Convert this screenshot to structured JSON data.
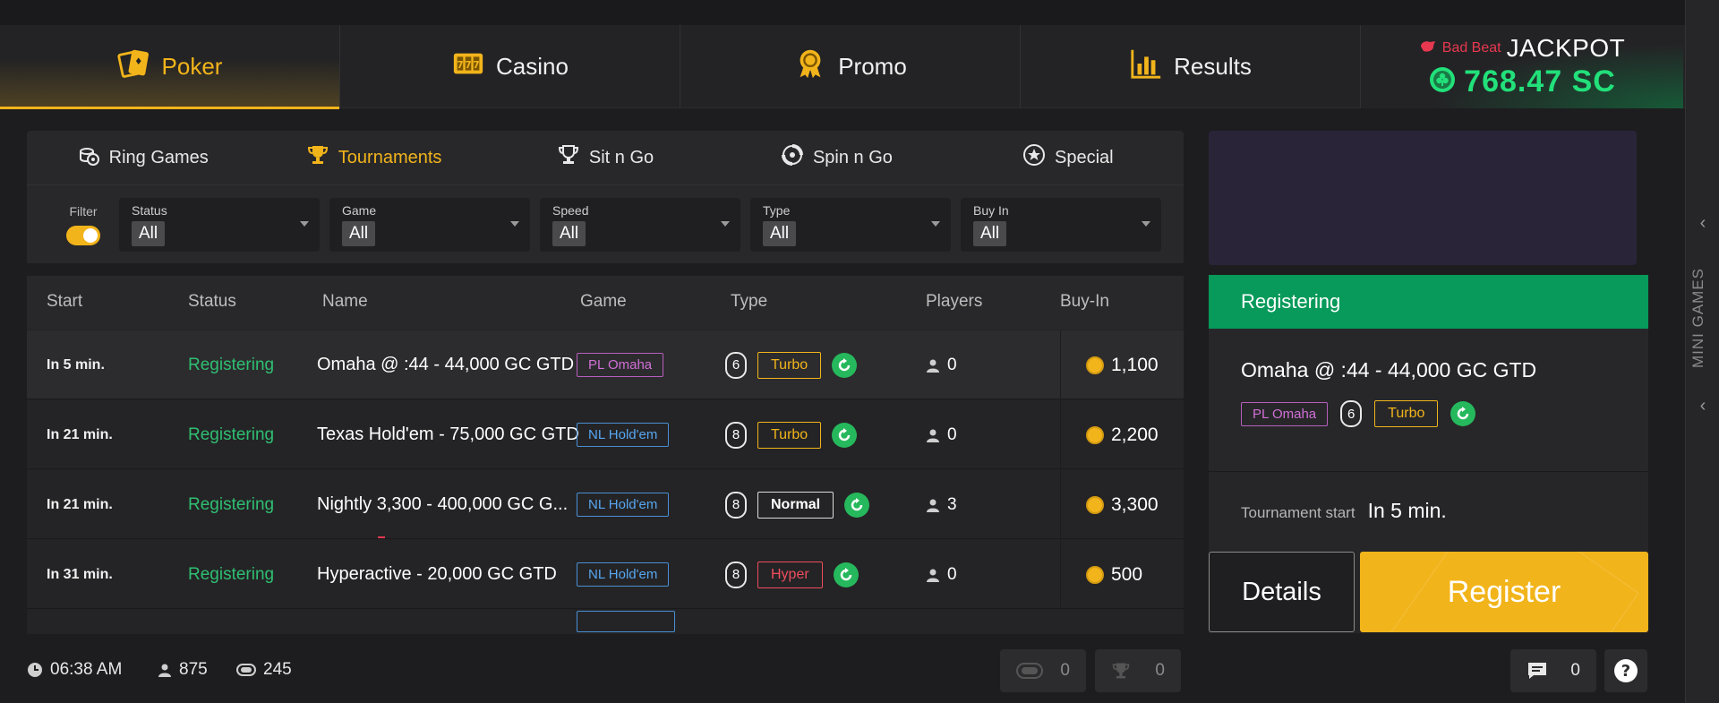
{
  "main_nav": {
    "tabs": [
      {
        "label": "Poker",
        "icon": "poker-cards-icon",
        "active": true
      },
      {
        "label": "Casino",
        "icon": "slot-777-icon",
        "active": false
      },
      {
        "label": "Promo",
        "icon": "medal-icon",
        "active": false
      },
      {
        "label": "Results",
        "icon": "bar-chart-icon",
        "active": false
      }
    ],
    "jackpot": {
      "badge": "Bad Beat",
      "title": "JACKPOT",
      "amount": "768.47 SC"
    }
  },
  "right_rail": {
    "label": "MINI GAMES"
  },
  "sub_nav": {
    "tabs": [
      {
        "label": "Ring Games",
        "icon": "chips-icon",
        "active": false
      },
      {
        "label": "Tournaments",
        "icon": "trophy-icon",
        "active": true
      },
      {
        "label": "Sit n Go",
        "icon": "trophy-outline-icon",
        "active": false
      },
      {
        "label": "Spin n Go",
        "icon": "spin-icon",
        "active": false
      },
      {
        "label": "Special",
        "icon": "star-icon",
        "active": false
      }
    ]
  },
  "filters": {
    "toggle_label": "Filter",
    "selects": [
      {
        "label": "Status",
        "value": "All"
      },
      {
        "label": "Game",
        "value": "All"
      },
      {
        "label": "Speed",
        "value": "All"
      },
      {
        "label": "Type",
        "value": "All"
      },
      {
        "label": "Buy In",
        "value": "All"
      }
    ]
  },
  "table": {
    "headers": [
      "Start",
      "Status",
      "Name",
      "Game",
      "Type",
      "Players",
      "Buy-In"
    ],
    "rows": [
      {
        "start": "In 5 min.",
        "status": "Registering",
        "name": "Omaha @ :44 - 44,000 GC GTD",
        "game": "PL Omaha",
        "seats": "6",
        "speed": "Turbo",
        "players": "0",
        "buyin": "1,100"
      },
      {
        "start": "In 21 min.",
        "status": "Registering",
        "name": "Texas Hold'em - 75,000 GC GTD",
        "game": "NL Hold'em",
        "seats": "8",
        "speed": "Turbo",
        "players": "0",
        "buyin": "2,200"
      },
      {
        "start": "In 21 min.",
        "status": "Registering",
        "name": "Nightly 3,300 - 400,000 GC G...",
        "game": "NL Hold'em",
        "seats": "8",
        "speed": "Normal",
        "players": "3",
        "buyin": "3,300"
      },
      {
        "start": "In 31 min.",
        "status": "Registering",
        "name": "Hyperactive - 20,000 GC GTD",
        "game": "NL Hold'em",
        "seats": "8",
        "speed": "Hyper",
        "players": "0",
        "buyin": "500"
      }
    ]
  },
  "detail": {
    "status": "Registering",
    "title": "Omaha @ :44 - 44,000 GC GTD",
    "game": "PL Omaha",
    "seats": "6",
    "speed": "Turbo",
    "start_label": "Tournament start",
    "start_value": "In 5 min.",
    "details_button": "Details",
    "register_button": "Register"
  },
  "footer": {
    "time": "06:38 AM",
    "players_online": "875",
    "tables": "245",
    "my_tables": "0",
    "my_tournaments": "0",
    "chat_count": "0"
  },
  "colors": {
    "accent": "#f2b41b",
    "green": "#079a5a",
    "jackpot_green": "#22e07a",
    "bg": "#1d1d1f"
  }
}
